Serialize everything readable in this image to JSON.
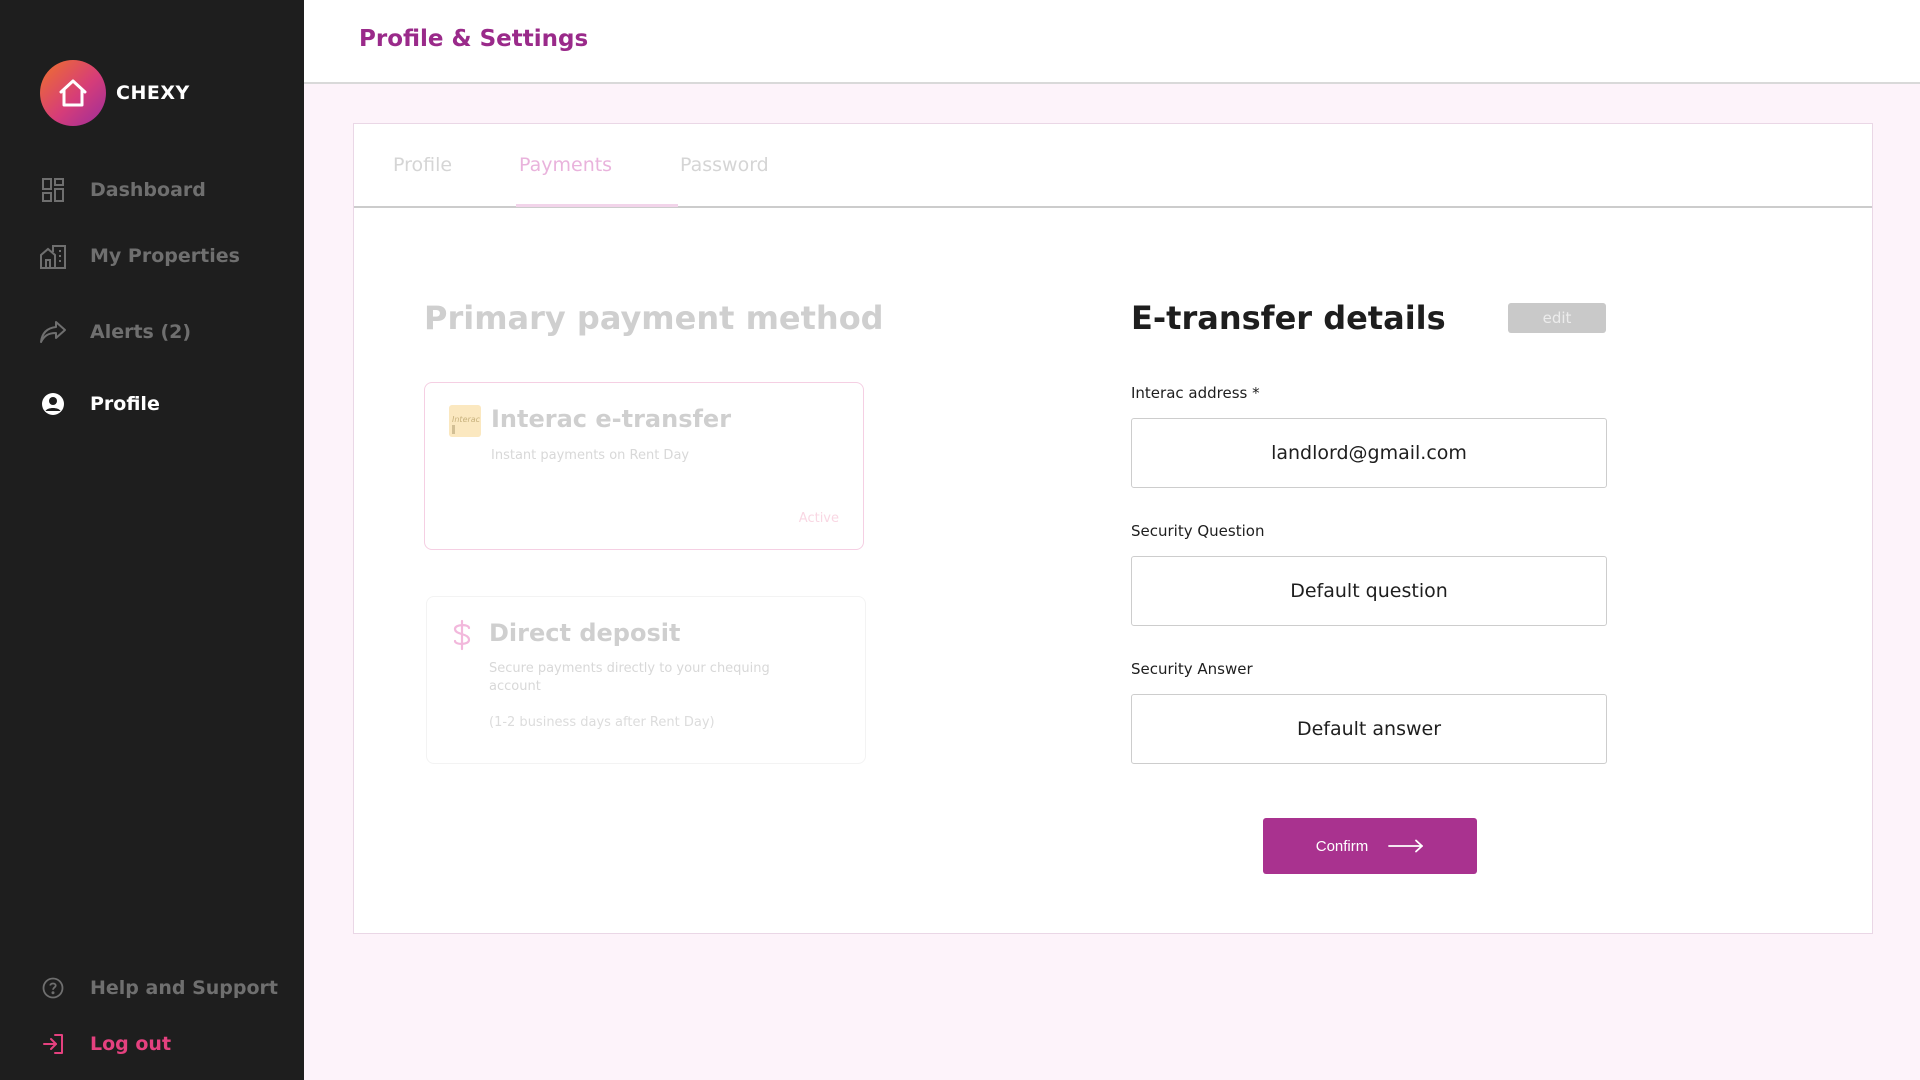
{
  "app": {
    "brand_name": "CHEXY"
  },
  "sidebar": {
    "items": [
      {
        "label": "Dashboard",
        "icon": "dashboard-icon"
      },
      {
        "label": "My Properties",
        "icon": "building-icon"
      },
      {
        "label": "Alerts (2)",
        "icon": "share-arrow-icon"
      },
      {
        "label": "Profile",
        "icon": "user-circle-icon",
        "active": true
      }
    ],
    "footer": [
      {
        "label": "Help and Support",
        "icon": "help-circle-icon"
      },
      {
        "label": "Log out",
        "icon": "logout-icon"
      }
    ]
  },
  "header": {
    "title": "Profile & Settings"
  },
  "tabs": [
    {
      "label": "Profile"
    },
    {
      "label": "Payments",
      "active": true
    },
    {
      "label": "Password"
    }
  ],
  "payment_methods": {
    "title": "Primary payment method",
    "interac": {
      "title": "Interac e-transfer",
      "subtitle": "Instant payments on Rent Day",
      "status": "Active",
      "logo_text": "Interac"
    },
    "direct_deposit": {
      "title": "Direct deposit",
      "subtitle": "Secure payments directly to your chequing account",
      "note": "(1-2 business days after Rent Day)"
    }
  },
  "etransfer": {
    "title": "E-transfer details",
    "edit_label": "edit",
    "fields": {
      "address": {
        "label": "Interac address *",
        "value": "landlord@gmail.com"
      },
      "question": {
        "label": "Security Question",
        "value": "Default question"
      },
      "answer": {
        "label": "Security Answer",
        "value": "Default answer"
      }
    },
    "confirm_label": "Confirm"
  },
  "colors": {
    "accent": "#a9328f",
    "title": "#9a2a8a",
    "sidebar_bg": "#1e1e1e",
    "logout": "#e5417f",
    "page_bg": "#fdf3fa"
  }
}
